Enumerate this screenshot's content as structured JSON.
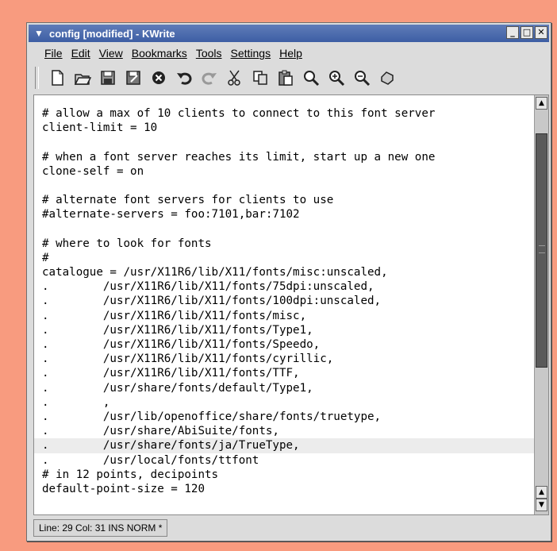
{
  "window": {
    "title": "config [modified] - KWrite"
  },
  "menu": [
    "File",
    "Edit",
    "View",
    "Bookmarks",
    "Tools",
    "Settings",
    "Help"
  ],
  "toolbar_icons": [
    "new-document-icon",
    "open-icon",
    "save-icon",
    "save-as-icon",
    "close-icon",
    "undo-icon",
    "redo-icon",
    "cut-icon",
    "copy-icon",
    "paste-icon",
    "find-icon",
    "zoom-in-icon",
    "zoom-out-icon",
    "print-icon"
  ],
  "editor": {
    "lines": [
      "# allow a max of 10 clients to connect to this font server",
      "client-limit = 10",
      "",
      "# when a font server reaches its limit, start up a new one",
      "clone-self = on",
      "",
      "# alternate font servers for clients to use",
      "#alternate-servers = foo:7101,bar:7102",
      "",
      "# where to look for fonts",
      "#",
      "catalogue = /usr/X11R6/lib/X11/fonts/misc:unscaled,",
      ".        /usr/X11R6/lib/X11/fonts/75dpi:unscaled,",
      ".        /usr/X11R6/lib/X11/fonts/100dpi:unscaled,",
      ".        /usr/X11R6/lib/X11/fonts/misc,",
      ".        /usr/X11R6/lib/X11/fonts/Type1,",
      ".        /usr/X11R6/lib/X11/fonts/Speedo,",
      ".        /usr/X11R6/lib/X11/fonts/cyrillic,",
      ".        /usr/X11R6/lib/X11/fonts/TTF,",
      ".        /usr/share/fonts/default/Type1,",
      ".        ,",
      ".        /usr/lib/openoffice/share/fonts/truetype,",
      ".        /usr/share/AbiSuite/fonts,",
      ".        /usr/share/fonts/ja/TrueType,",
      ".        /usr/local/fonts/ttfont",
      "# in 12 points, decipoints",
      "default-point-size = 120"
    ],
    "current_line_index": 23
  },
  "status": {
    "text": "Line: 29 Col: 31  INS  NORM  *"
  }
}
